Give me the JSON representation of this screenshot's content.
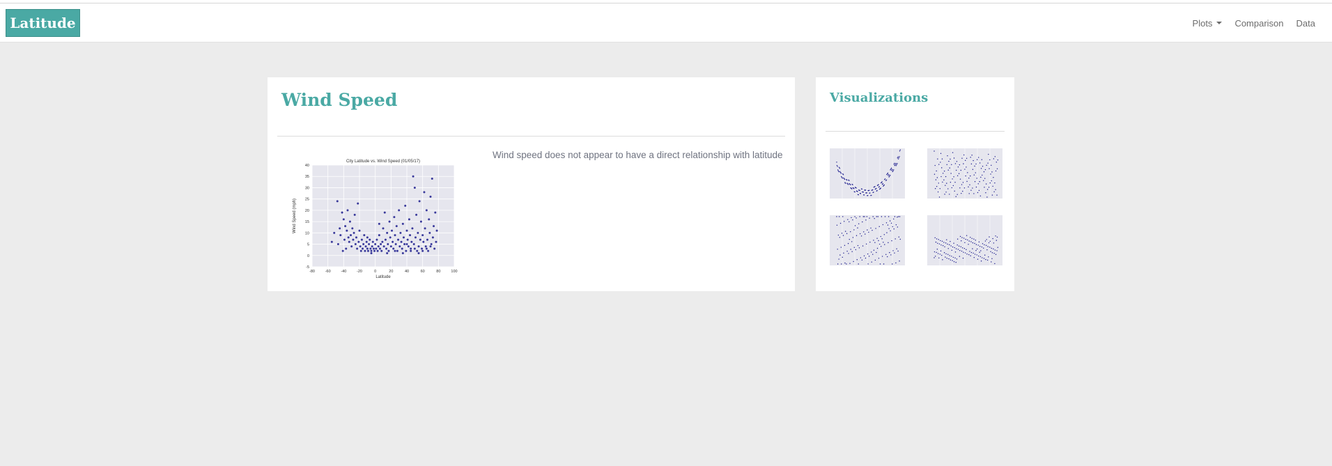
{
  "navbar": {
    "brand": "Latitude",
    "links": [
      {
        "label": "Plots",
        "has_dropdown": true
      },
      {
        "label": "Comparison",
        "has_dropdown": false
      },
      {
        "label": "Data",
        "has_dropdown": false
      }
    ]
  },
  "main": {
    "title": "Wind Speed",
    "description": "Wind speed does not appear to have a direct relationship with latitude"
  },
  "sidebar": {
    "title": "Visualizations",
    "thumbnails": [
      "temperature-plot-thumbnail",
      "humidity-plot-thumbnail",
      "cloudiness-plot-thumbnail",
      "wind-speed-plot-thumbnail"
    ]
  },
  "colors": {
    "accent": "#4aa9a4",
    "marker": "#1a1a8c",
    "plot_bg": "#e6e6ee"
  },
  "chart_data": {
    "type": "scatter",
    "title": "City Latitude vs. Wind Speed (01/05/17)",
    "xlabel": "Latitude",
    "ylabel": "Wind Speed (mph)",
    "xlim": [
      -80,
      100
    ],
    "ylim": [
      -5,
      40
    ],
    "xticks": [
      -80,
      -60,
      -40,
      -20,
      0,
      20,
      40,
      60,
      80,
      100
    ],
    "yticks": [
      -5,
      0,
      5,
      10,
      15,
      20,
      25,
      30,
      35,
      40
    ],
    "grid": true,
    "series": [
      {
        "points": [
          [
            -55,
            6
          ],
          [
            -52,
            10
          ],
          [
            -48,
            24
          ],
          [
            -47,
            5
          ],
          [
            -45,
            12
          ],
          [
            -44,
            9
          ],
          [
            -42,
            19
          ],
          [
            -40,
            16
          ],
          [
            -39,
            7
          ],
          [
            -38,
            13
          ],
          [
            -36,
            11
          ],
          [
            -35,
            20
          ],
          [
            -34,
            8
          ],
          [
            -33,
            6
          ],
          [
            -32,
            15
          ],
          [
            -31,
            9
          ],
          [
            -30,
            4
          ],
          [
            -29,
            12
          ],
          [
            -28,
            7
          ],
          [
            -27,
            10
          ],
          [
            -26,
            18
          ],
          [
            -25,
            5
          ],
          [
            -24,
            8
          ],
          [
            -23,
            3
          ],
          [
            -22,
            23
          ],
          [
            -21,
            6
          ],
          [
            -20,
            11
          ],
          [
            -19,
            4
          ],
          [
            -18,
            2
          ],
          [
            -17,
            7
          ],
          [
            -16,
            3
          ],
          [
            -15,
            5
          ],
          [
            -14,
            9
          ],
          [
            -13,
            2
          ],
          [
            -12,
            4
          ],
          [
            -11,
            6
          ],
          [
            -10,
            3
          ],
          [
            -9,
            2
          ],
          [
            -8,
            5
          ],
          [
            -7,
            7
          ],
          [
            -6,
            3
          ],
          [
            -5,
            2
          ],
          [
            -4,
            4
          ],
          [
            -3,
            6
          ],
          [
            -2,
            3
          ],
          [
            -1,
            2
          ],
          [
            0,
            5
          ],
          [
            1,
            3
          ],
          [
            2,
            7
          ],
          [
            3,
            2
          ],
          [
            4,
            4
          ],
          [
            5,
            9
          ],
          [
            6,
            3
          ],
          [
            7,
            5
          ],
          [
            8,
            2
          ],
          [
            9,
            6
          ],
          [
            10,
            12
          ],
          [
            11,
            4
          ],
          [
            12,
            19
          ],
          [
            13,
            7
          ],
          [
            14,
            3
          ],
          [
            15,
            10
          ],
          [
            16,
            5
          ],
          [
            17,
            2
          ],
          [
            18,
            15
          ],
          [
            19,
            8
          ],
          [
            20,
            4
          ],
          [
            21,
            11
          ],
          [
            22,
            6
          ],
          [
            23,
            3
          ],
          [
            24,
            17
          ],
          [
            25,
            9
          ],
          [
            26,
            5
          ],
          [
            27,
            13
          ],
          [
            28,
            2
          ],
          [
            29,
            7
          ],
          [
            30,
            20
          ],
          [
            31,
            4
          ],
          [
            32,
            10
          ],
          [
            33,
            6
          ],
          [
            34,
            3
          ],
          [
            35,
            14
          ],
          [
            36,
            8
          ],
          [
            37,
            5
          ],
          [
            38,
            22
          ],
          [
            39,
            2
          ],
          [
            40,
            11
          ],
          [
            41,
            7
          ],
          [
            42,
            4
          ],
          [
            43,
            16
          ],
          [
            44,
            9
          ],
          [
            45,
            3
          ],
          [
            46,
            6
          ],
          [
            47,
            12
          ],
          [
            48,
            35
          ],
          [
            49,
            5
          ],
          [
            50,
            30
          ],
          [
            51,
            8
          ],
          [
            52,
            18
          ],
          [
            53,
            2
          ],
          [
            54,
            10
          ],
          [
            55,
            4
          ],
          [
            56,
            24
          ],
          [
            57,
            7
          ],
          [
            58,
            15
          ],
          [
            59,
            3
          ],
          [
            60,
            9
          ],
          [
            61,
            6
          ],
          [
            62,
            28
          ],
          [
            63,
            12
          ],
          [
            64,
            4
          ],
          [
            65,
            20
          ],
          [
            66,
            7
          ],
          [
            67,
            2
          ],
          [
            68,
            16
          ],
          [
            69,
            10
          ],
          [
            70,
            26
          ],
          [
            71,
            5
          ],
          [
            72,
            34
          ],
          [
            73,
            8
          ],
          [
            74,
            13
          ],
          [
            75,
            3
          ],
          [
            76,
            19
          ],
          [
            77,
            6
          ],
          [
            78,
            11
          ],
          [
            -41,
            2
          ],
          [
            -37,
            3
          ],
          [
            -10,
            8
          ],
          [
            5,
            14
          ],
          [
            25,
            2
          ],
          [
            35,
            1
          ],
          [
            45,
            2
          ],
          [
            55,
            1
          ],
          [
            65,
            3
          ],
          [
            15,
            1
          ],
          [
            -5,
            1
          ],
          [
            60,
            2
          ],
          [
            70,
            4
          ],
          [
            50,
            3
          ],
          [
            40,
            5
          ]
        ]
      }
    ]
  }
}
